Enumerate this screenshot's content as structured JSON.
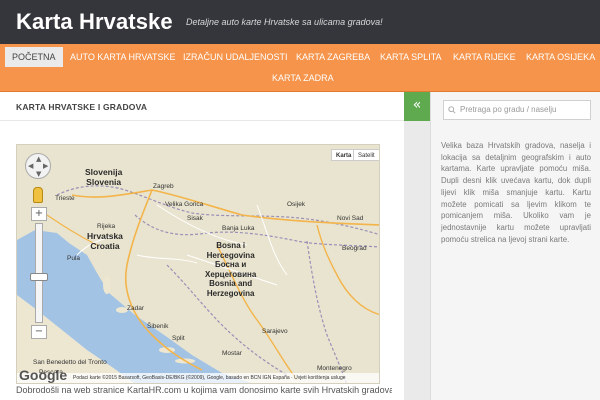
{
  "header": {
    "title": "Karta Hrvatske",
    "description": "Detaljne auto karte Hrvatske sa ulicama gradova!"
  },
  "nav": {
    "items": [
      {
        "label": "Početna",
        "active": true
      },
      {
        "label": "Auto karta Hrvatske",
        "active": false
      },
      {
        "label": "Izračun udaljenosti",
        "active": false
      },
      {
        "label": "Karta Zagreba",
        "active": false
      },
      {
        "label": "Karta Splita",
        "active": false
      },
      {
        "label": "Karta Rijeke",
        "active": false
      },
      {
        "label": "Karta Osijeka",
        "active": false
      },
      {
        "label": "Karta Zadra",
        "active": false
      }
    ]
  },
  "main": {
    "title": "Karta Hrvatske i gradova",
    "intro": "Dobrodošli na web stranice KartaHR.com u kojima vam donosimo karte svih Hrvatskih gradova te"
  },
  "map": {
    "type_buttons": [
      "Karta",
      "Satelit"
    ],
    "countries": [
      {
        "name": "Slovenija\nSlovenia"
      },
      {
        "name": "Hrvatska\nCroatia"
      },
      {
        "name": "Bosna i\nHercegovina\nБосна и\nХерцеговина\nBosnia and\nHerzegovina"
      }
    ],
    "cities": [
      "Zagreb",
      "Trieste",
      "Velika Gorica",
      "Sarajevo",
      "Sisak",
      "Banja Luka",
      "Split",
      "Zadar",
      "Rijeka",
      "Pula",
      "Šibenik",
      "Mostar",
      "Novi Sad",
      "Beograd",
      "Osijek",
      "San Benedetto del Tronto",
      "Pescara",
      "Montenegro"
    ],
    "footer": "Podaci karte ©2015 Basarsoft, GeoBasis-DE/BKG (©2009), Google, basado en BCN IGN España · Uvjeti korištenja usluge",
    "logo": "Google",
    "zoom_plus": "+",
    "zoom_minus": "−"
  },
  "sidebar": {
    "toggle_icon": "«",
    "search_placeholder": "Pretraga po gradu / naselju",
    "text": "Velika baza Hrvatskih gradova, naselja i lokacija sa detaljnim geografskim i auto kartama. Karte upravljate pomoću miša. Dupli desni klik uvećava kartu, dok dupli lijevi klik miša smanjuje kartu. Kartu možete pomicati sa ljevim klikom te pomicanjem miša. Ukoliko vam je jednostavnije kartu možete upravljati pomoću strelica na ljevoj strani karte."
  },
  "colors": {
    "header_bg": "#34363b",
    "nav_bg": "#f5944a",
    "toggle_bg": "#5faa4f"
  }
}
